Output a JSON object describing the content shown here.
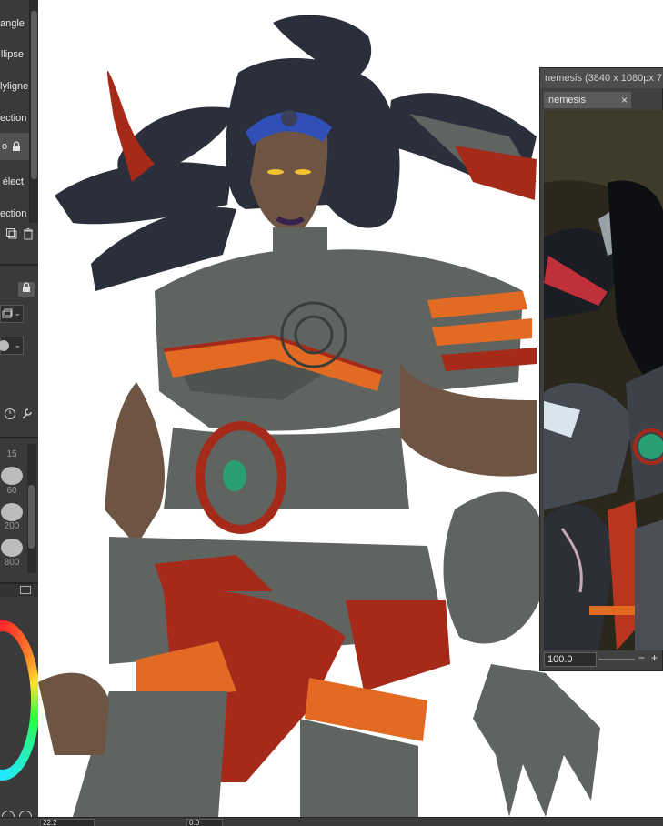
{
  "tools": {
    "items": [
      {
        "label": "angle",
        "active": false
      },
      {
        "label": "llipse",
        "active": false
      },
      {
        "label": "lyligne",
        "active": false
      },
      {
        "label": "ection",
        "active": false
      },
      {
        "label": "o",
        "active": true
      },
      {
        "label": "élect",
        "active": false
      },
      {
        "label": "ection",
        "active": false
      }
    ]
  },
  "brush_sizes": [
    "15",
    "60",
    "200",
    "800"
  ],
  "navigator": {
    "title": "nemesis (3840 x 1080px 7",
    "tab_label": "nemesis",
    "close_glyph": "×",
    "zoom_value": "100.0",
    "minus": "−",
    "plus": "+"
  },
  "status_bar": {
    "zoom_field": "22.2",
    "angle_field": "0.0"
  },
  "colors": {
    "panel_bg": "#3a3a3a",
    "armor_gray": "#5f6460",
    "skin": "#6d5443",
    "hair": "#2b2f3c",
    "red_cloth": "#a52a1a",
    "orange_trim": "#e26a22",
    "gem_green": "#2aa072",
    "tiara_blue": "#3050b8"
  },
  "icons": {
    "lock": "🔒",
    "chevron": "⌄"
  }
}
